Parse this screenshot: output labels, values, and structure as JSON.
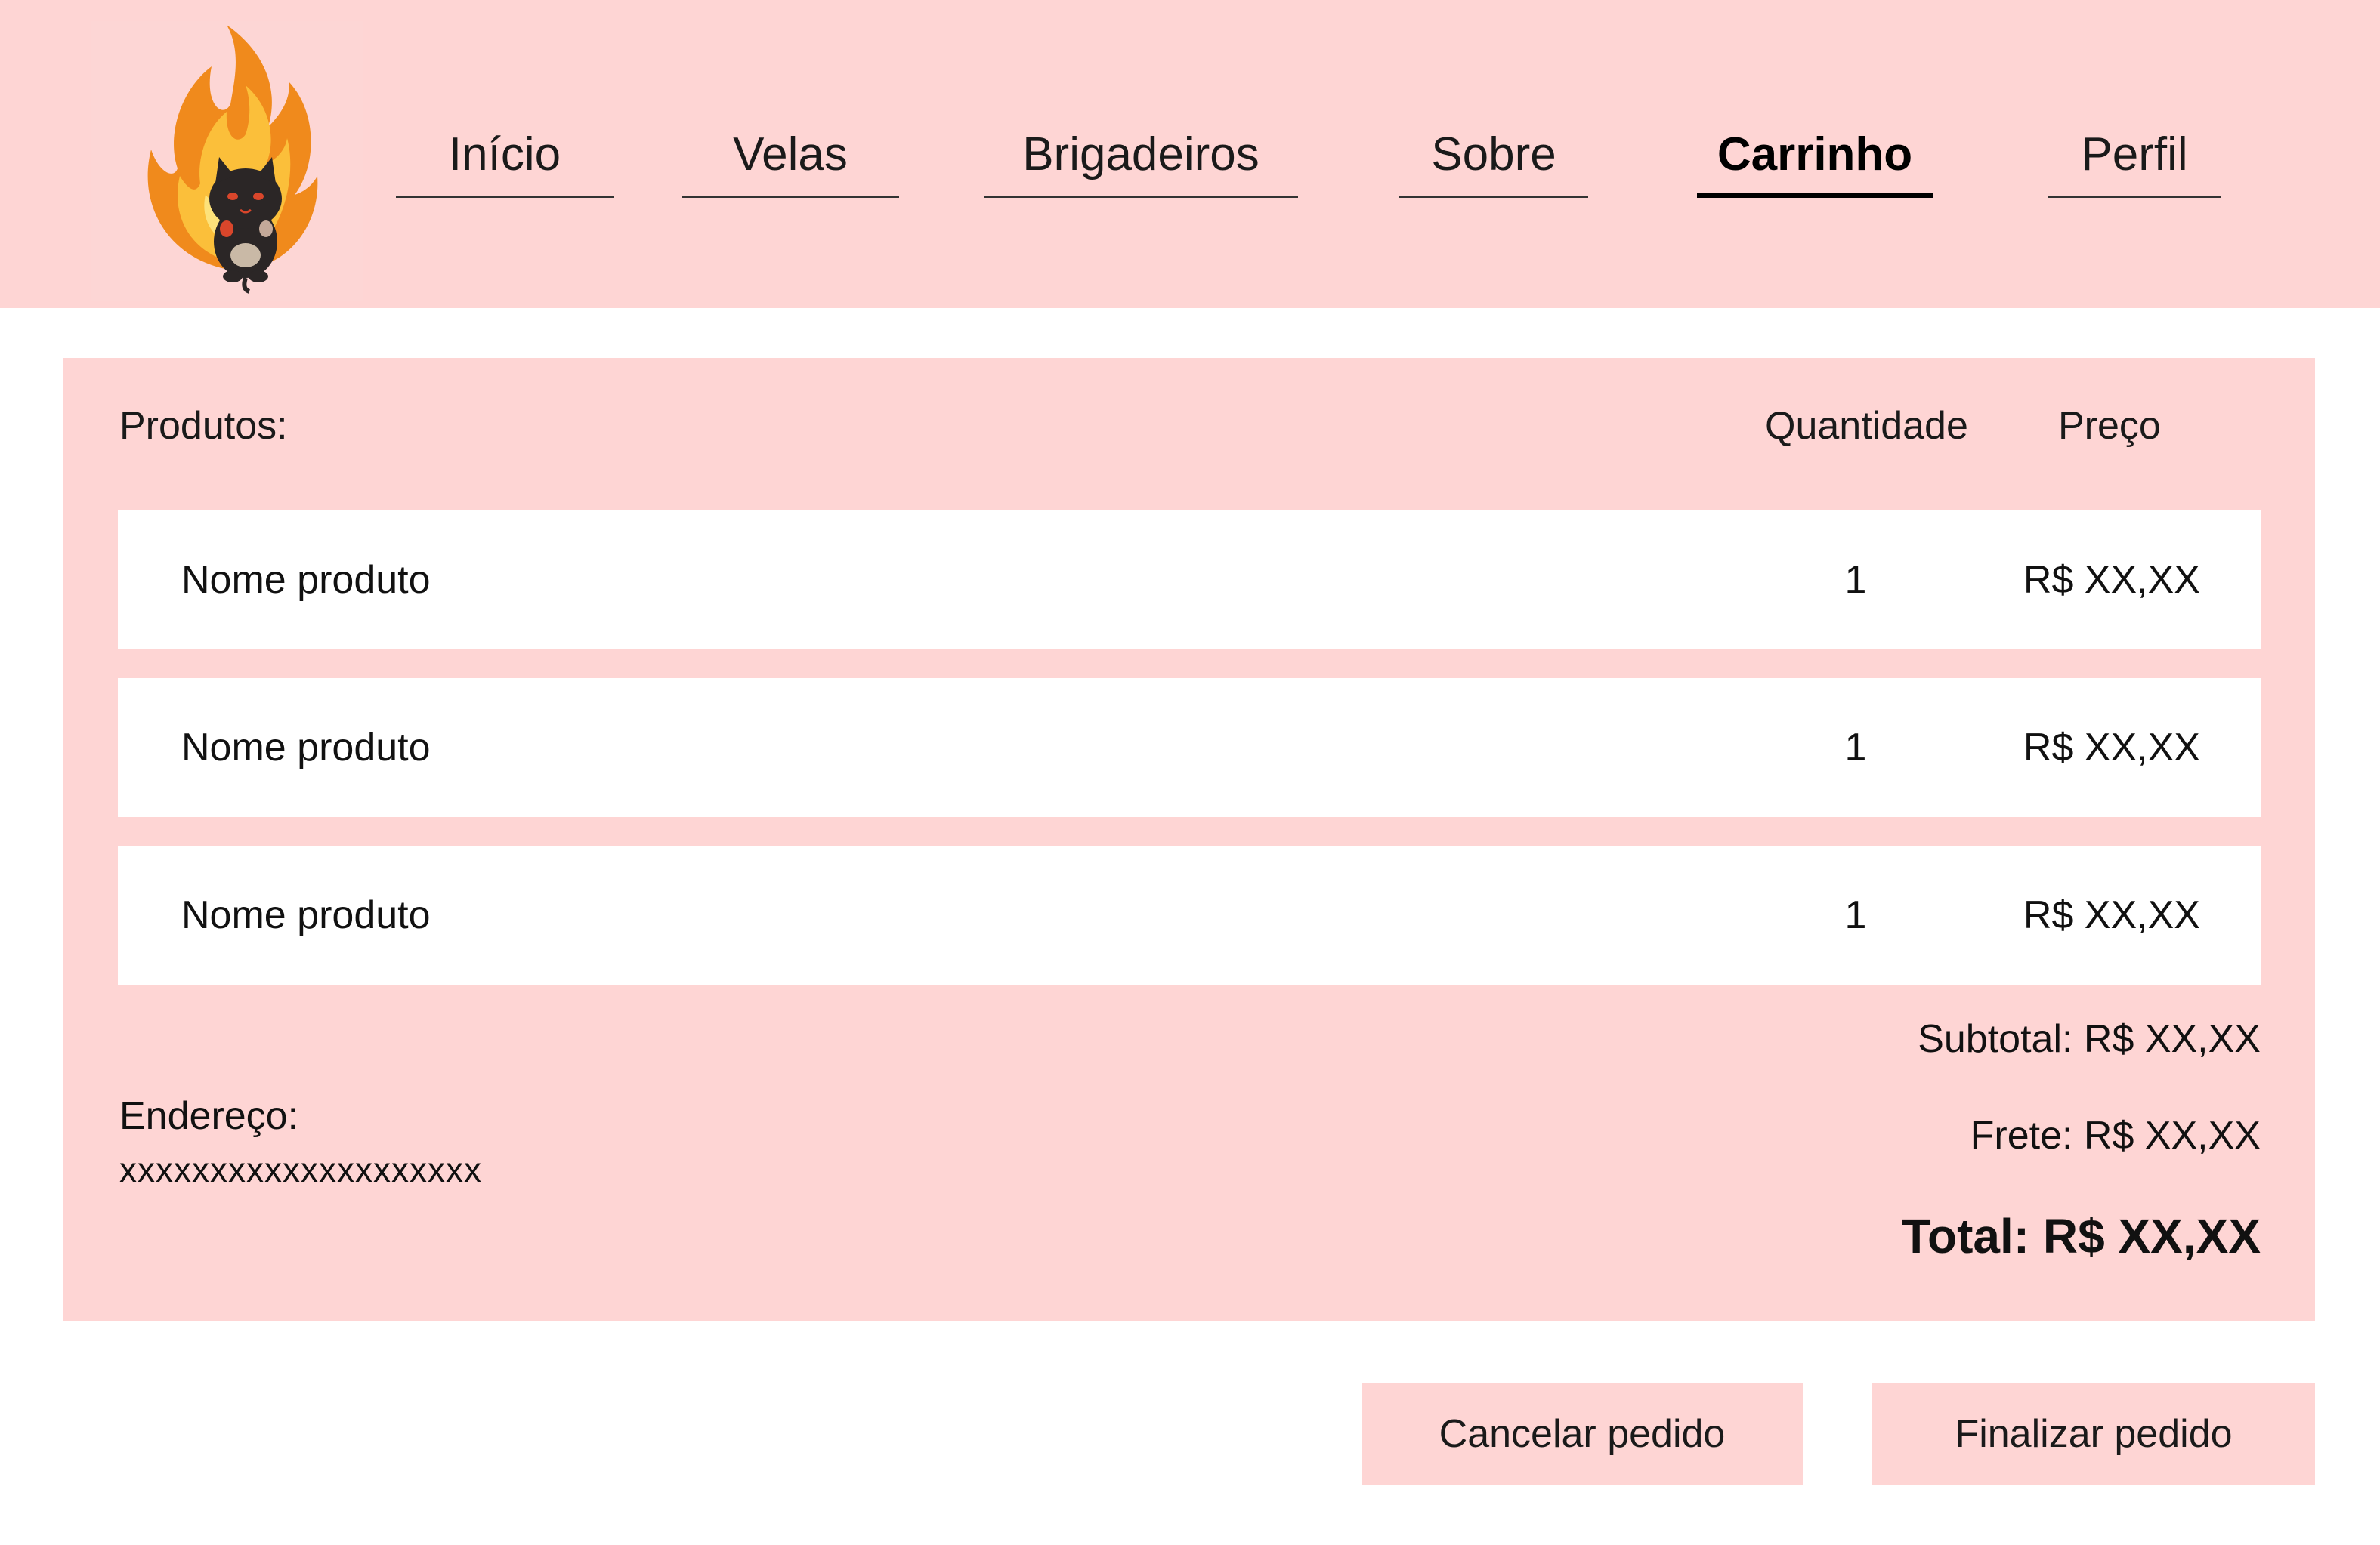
{
  "header": {
    "logo": {
      "icon": "flame-cat-mascot-icon"
    },
    "nav": [
      {
        "label": "Início",
        "active": false
      },
      {
        "label": "Velas",
        "active": false
      },
      {
        "label": "Brigadeiros",
        "active": false
      },
      {
        "label": "Sobre",
        "active": false
      },
      {
        "label": "Carrinho",
        "active": true
      },
      {
        "label": "Perfil",
        "active": false
      }
    ]
  },
  "cart": {
    "columns": {
      "products": "Produtos:",
      "quantity": "Quantidade",
      "price": "Preço"
    },
    "items": [
      {
        "name": "Nome produto",
        "quantity": "1",
        "price": "R$ XX,XX"
      },
      {
        "name": "Nome produto",
        "quantity": "1",
        "price": "R$ XX,XX"
      },
      {
        "name": "Nome produto",
        "quantity": "1",
        "price": "R$ XX,XX"
      }
    ],
    "address": {
      "label": "Endereço:",
      "value": "xxxxxxxxxxxxxxxxxxxx"
    },
    "subtotal": "Subtotal: R$ XX,XX",
    "shipping": "Frete: R$ XX,XX",
    "total": "Total: R$ XX,XX"
  },
  "actions": {
    "cancel": "Cancelar pedido",
    "finish": "Finalizar pedido"
  },
  "colors": {
    "accent_pink": "#fed5d4",
    "row_background": "#ffffff",
    "text": "#111111"
  }
}
